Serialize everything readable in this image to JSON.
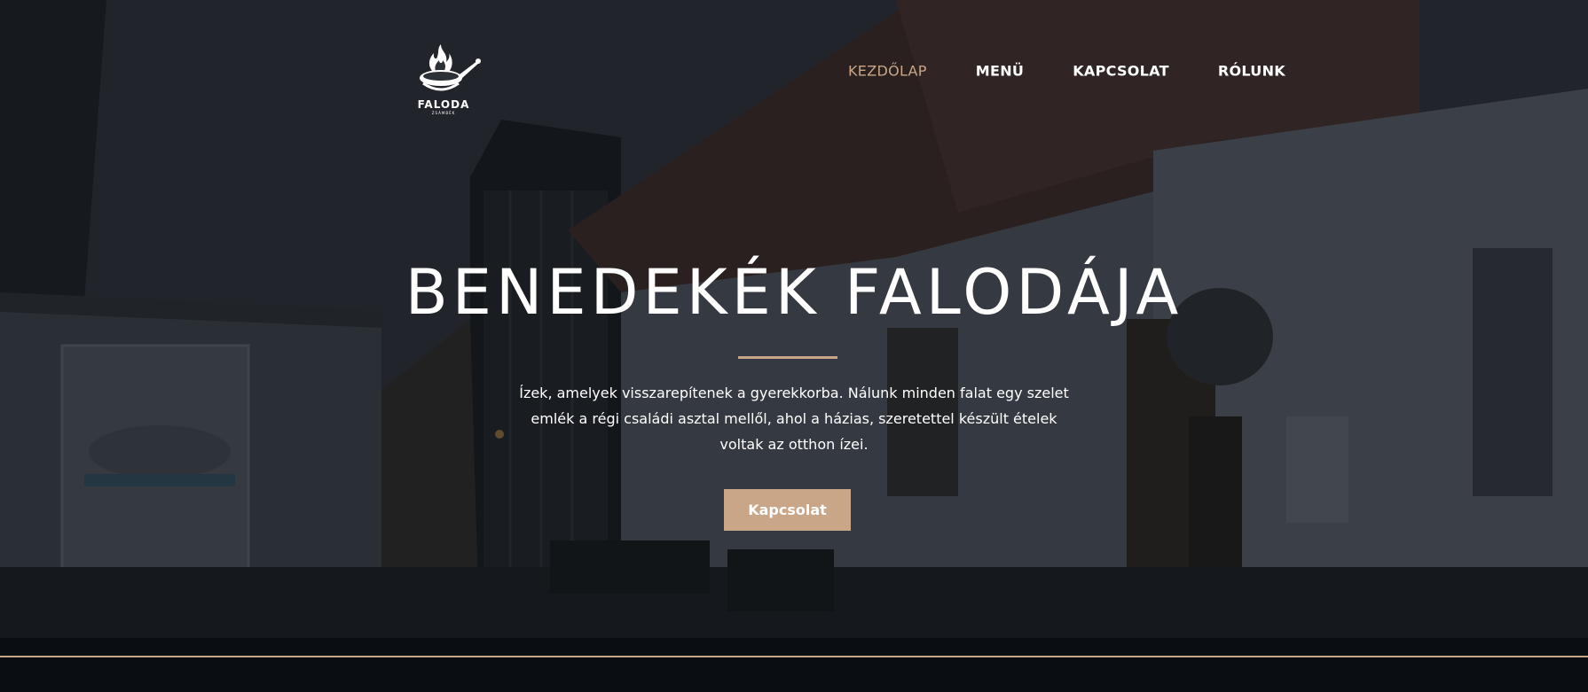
{
  "logo": {
    "name": "FALODA",
    "subtitle": "ZSÁMBÉK",
    "icon": "flaming-pan-icon"
  },
  "nav": {
    "items": [
      {
        "label": "KEZDŐLAP",
        "active": true
      },
      {
        "label": "MENÜ",
        "active": false
      },
      {
        "label": "KAPCSOLAT",
        "active": false
      },
      {
        "label": "RÓLUNK",
        "active": false
      }
    ]
  },
  "hero": {
    "title": "BENEDEKÉK FALODÁJA",
    "text": "Ízek, amelyek visszarepítenek a gyerekkorba. Nálunk minden falat egy szelet emlék a régi családi asztal mellől, ahol a házias, szeretettel készült ételek voltak az otthon ízei.",
    "button_label": "Kapcsolat"
  },
  "colors": {
    "accent": "#c9a688",
    "background": "#0a0e13",
    "text": "#ffffff"
  }
}
